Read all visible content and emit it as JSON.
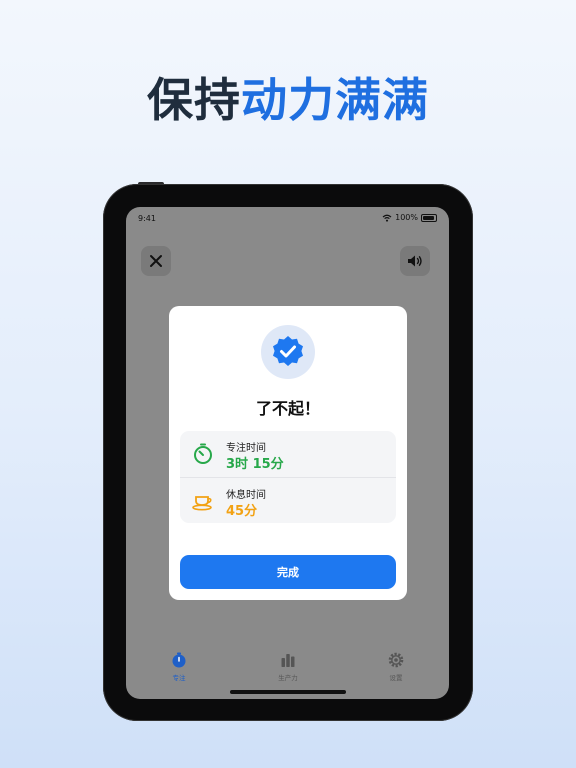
{
  "headline": {
    "part1": "保持",
    "part2": "动力满满"
  },
  "status_bar": {
    "time": "9:41",
    "battery": "100%"
  },
  "icons": {
    "close": "close-icon",
    "sound": "speaker-icon",
    "badge": "verified-badge-icon",
    "focus": "stopwatch-icon",
    "rest": "coffee-cup-icon",
    "tab_focus": "stopwatch-icon",
    "tab_productivity": "bar-chart-icon",
    "tab_settings": "gear-icon"
  },
  "dialog": {
    "title": "了不起！",
    "stats": [
      {
        "label": "专注时间",
        "value": "3时 15分"
      },
      {
        "label": "休息时间",
        "value": "45分"
      }
    ],
    "done_label": "完成"
  },
  "tabbar": {
    "items": [
      {
        "label": "专注"
      },
      {
        "label": "生产力"
      },
      {
        "label": "设置"
      }
    ]
  },
  "colors": {
    "accent": "#1e78f0",
    "focus_green": "#27a84a",
    "rest_orange": "#f2a214",
    "headline_blue": "#1f6fe0"
  }
}
